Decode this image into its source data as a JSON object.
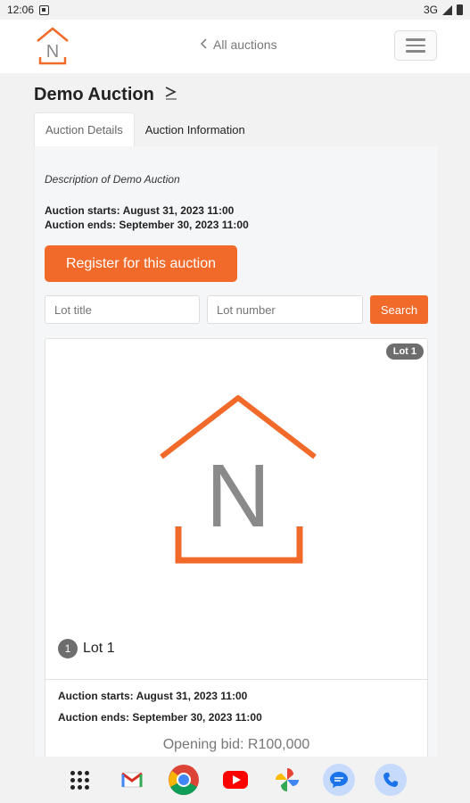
{
  "status_bar": {
    "time": "12:06",
    "network": "3G"
  },
  "header": {
    "back_link": "All auctions"
  },
  "logo": {
    "letter": "N",
    "accent": "#f26a2a",
    "letter_color": "#8a8a8a"
  },
  "page": {
    "title": "Demo Auction"
  },
  "tabs": [
    {
      "label": "Auction Details",
      "active": true
    },
    {
      "label": "Auction Information",
      "active": false
    }
  ],
  "details": {
    "description": "Description of Demo Auction",
    "starts": "Auction starts: August 31, 2023 11:00",
    "ends": "Auction ends: September 30, 2023 11:00",
    "register_label": "Register for this auction"
  },
  "search": {
    "lot_title_placeholder": "Lot title",
    "lot_number_placeholder": "Lot number",
    "button_label": "Search"
  },
  "lot": {
    "badge": "Lot 1",
    "number": "1",
    "name": "Lot 1",
    "starts": "Auction starts: August 31, 2023 11:00",
    "ends": "Auction ends: September 30, 2023 11:00",
    "opening_bid": "Opening bid: R100,000"
  },
  "nav_apps": [
    "apps-grid-icon",
    "gmail-icon",
    "chrome-icon",
    "youtube-icon",
    "photos-icon",
    "messages-icon",
    "phone-icon"
  ],
  "colors": {
    "accent": "#f26a2a",
    "badge_gray": "#6d6d6d"
  }
}
